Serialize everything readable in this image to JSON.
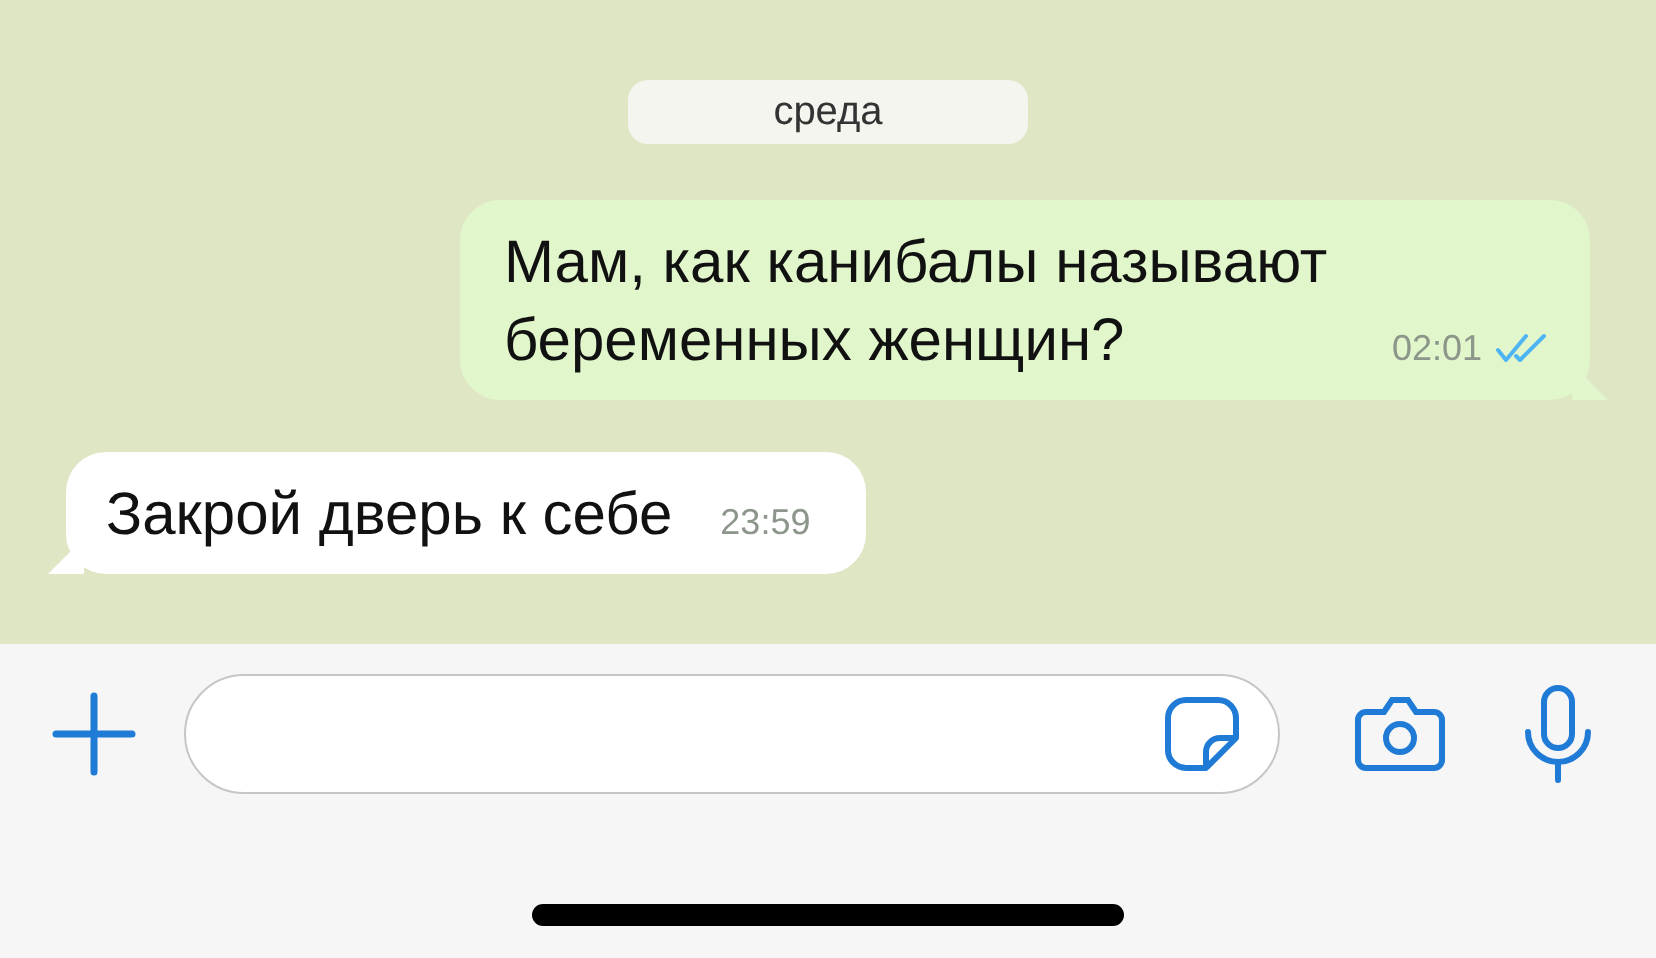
{
  "date_label": "среда",
  "messages": [
    {
      "kind": "outgoing",
      "text": "Мам, как канибалы называют беременных женщин?",
      "time": "02:01",
      "read": true
    },
    {
      "kind": "incoming",
      "text": "Закрой дверь к себе",
      "time": "23:59"
    }
  ]
}
